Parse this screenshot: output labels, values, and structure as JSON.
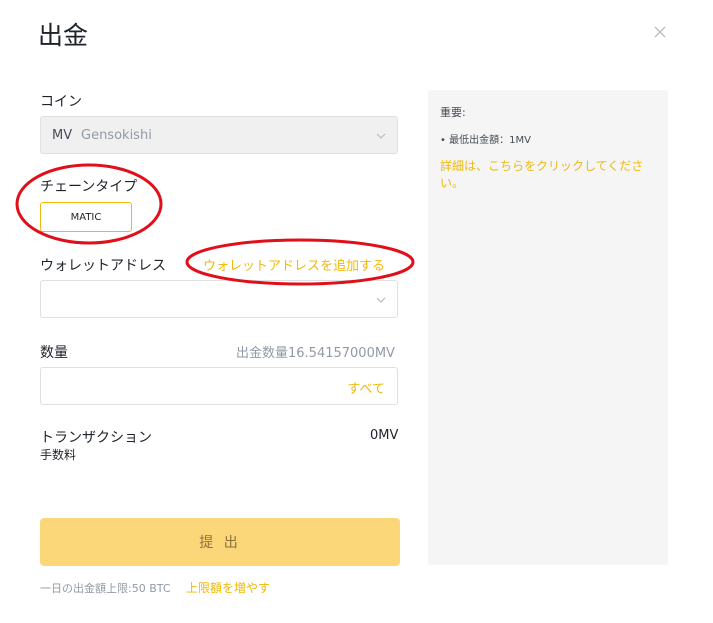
{
  "dialog": {
    "title": "出金"
  },
  "coin": {
    "label": "コイン",
    "symbol": "MV",
    "name": "Gensokishi"
  },
  "chain": {
    "label": "チェーンタイプ",
    "selected": "MATIC"
  },
  "address": {
    "label": "ウォレットアドレス",
    "add_link": "ウォレットアドレスを追加する",
    "value": ""
  },
  "amount": {
    "label": "数量",
    "available": "出金数量16.54157000MV",
    "all_button": "すべて",
    "value": ""
  },
  "fee": {
    "label_line1": "トランザクション",
    "label_line2": "手数料",
    "value": "0MV"
  },
  "submit": {
    "label": "提 出"
  },
  "footer": {
    "limit_text": "一日の出金額上限:50 BTC",
    "increase_link": "上限額を増やす"
  },
  "info": {
    "heading": "重要:",
    "min_withdraw": "• 最低出金額：1MV",
    "detail_link": "詳細は、こちらをクリックしてください。"
  },
  "colors": {
    "accent": "#f0b90b",
    "annotation": "#e0101a",
    "submit_bg": "#fcd77a"
  },
  "icons": {
    "close": "close-icon",
    "dropdown": "chevron-down-icon"
  }
}
